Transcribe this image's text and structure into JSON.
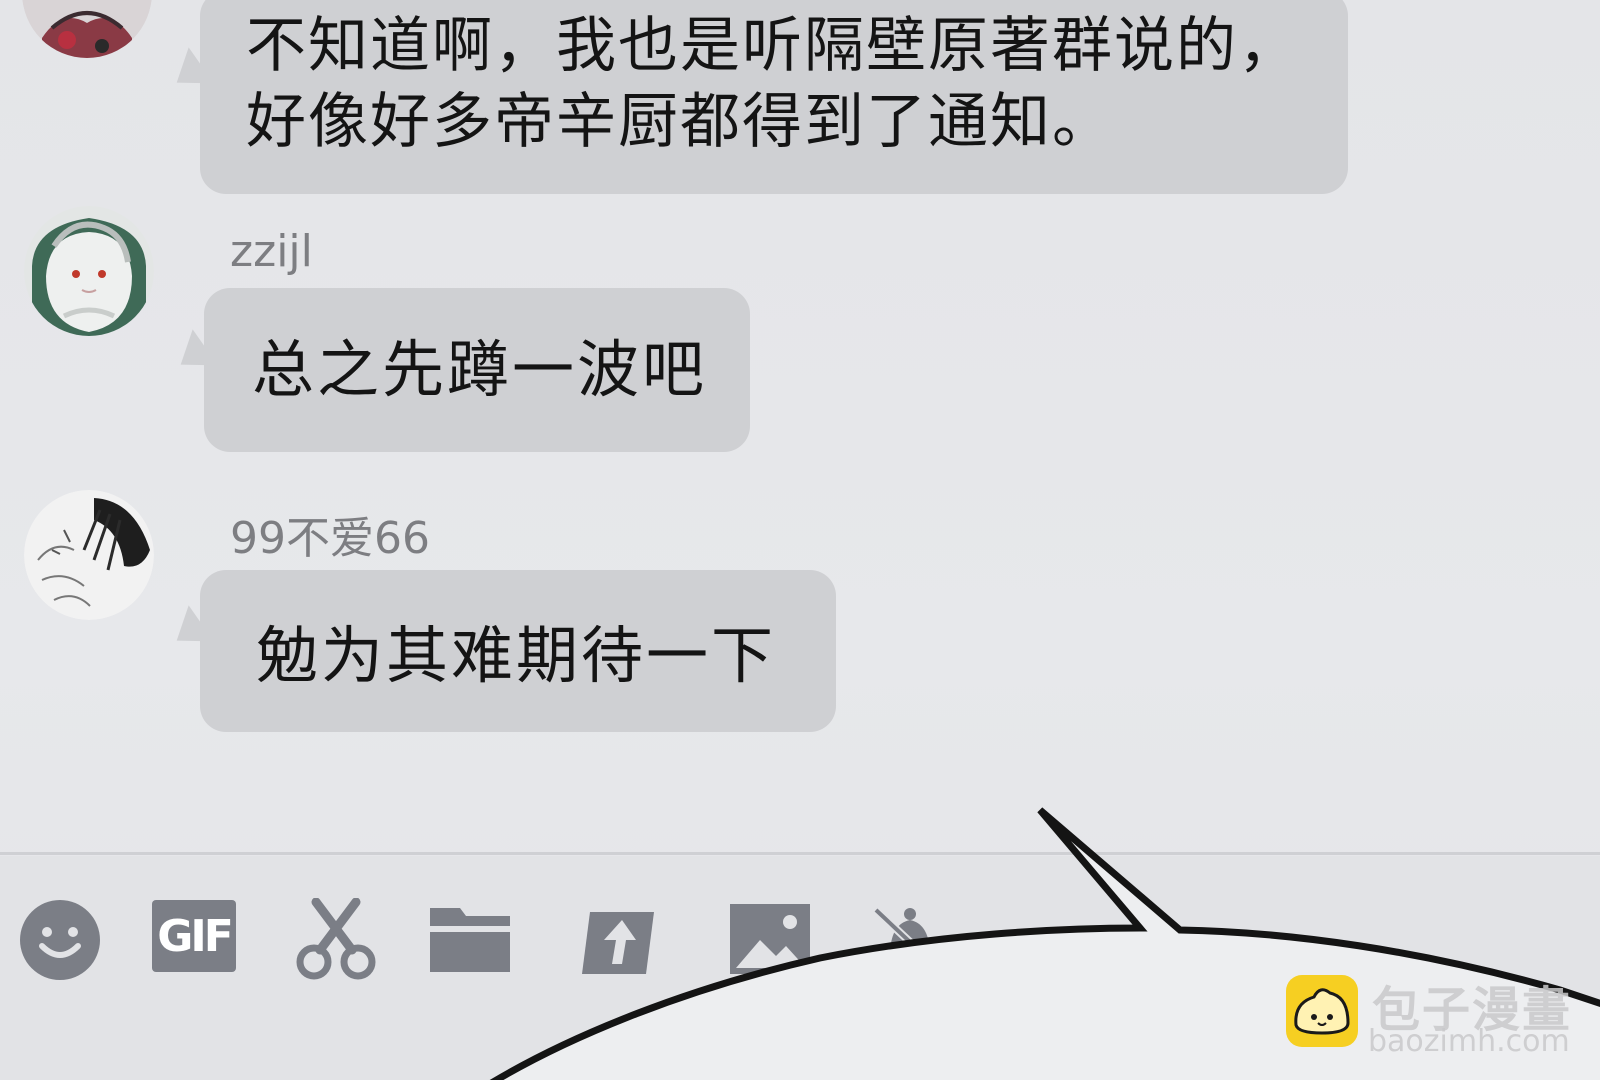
{
  "messages": [
    {
      "sender": "",
      "text": "不知道啊，我也是听隔壁原著群说的，\n好像好多帝辛厨都得到了通知。"
    },
    {
      "sender": "zzijl",
      "text": "总之先蹲一波吧"
    },
    {
      "sender": "99不爱66",
      "text": "勉为其难期待一下"
    }
  ],
  "toolbar": {
    "emoji_icon": "smiley-face-icon",
    "gif_label": "GIF",
    "scissors_icon": "scissors-icon",
    "folder_icon": "folder-icon",
    "share_icon": "share-arrow-icon",
    "image_icon": "image-icon",
    "mute_icon": "muted-bell-icon"
  },
  "watermark": {
    "title": "包子漫畫",
    "url": "baozimh.com"
  },
  "colors": {
    "background": "#e6e7ea",
    "bubble": "#cfd0d3",
    "toolbar_icon": "#7b7e86",
    "watermark_logo": "#f6cf22"
  }
}
